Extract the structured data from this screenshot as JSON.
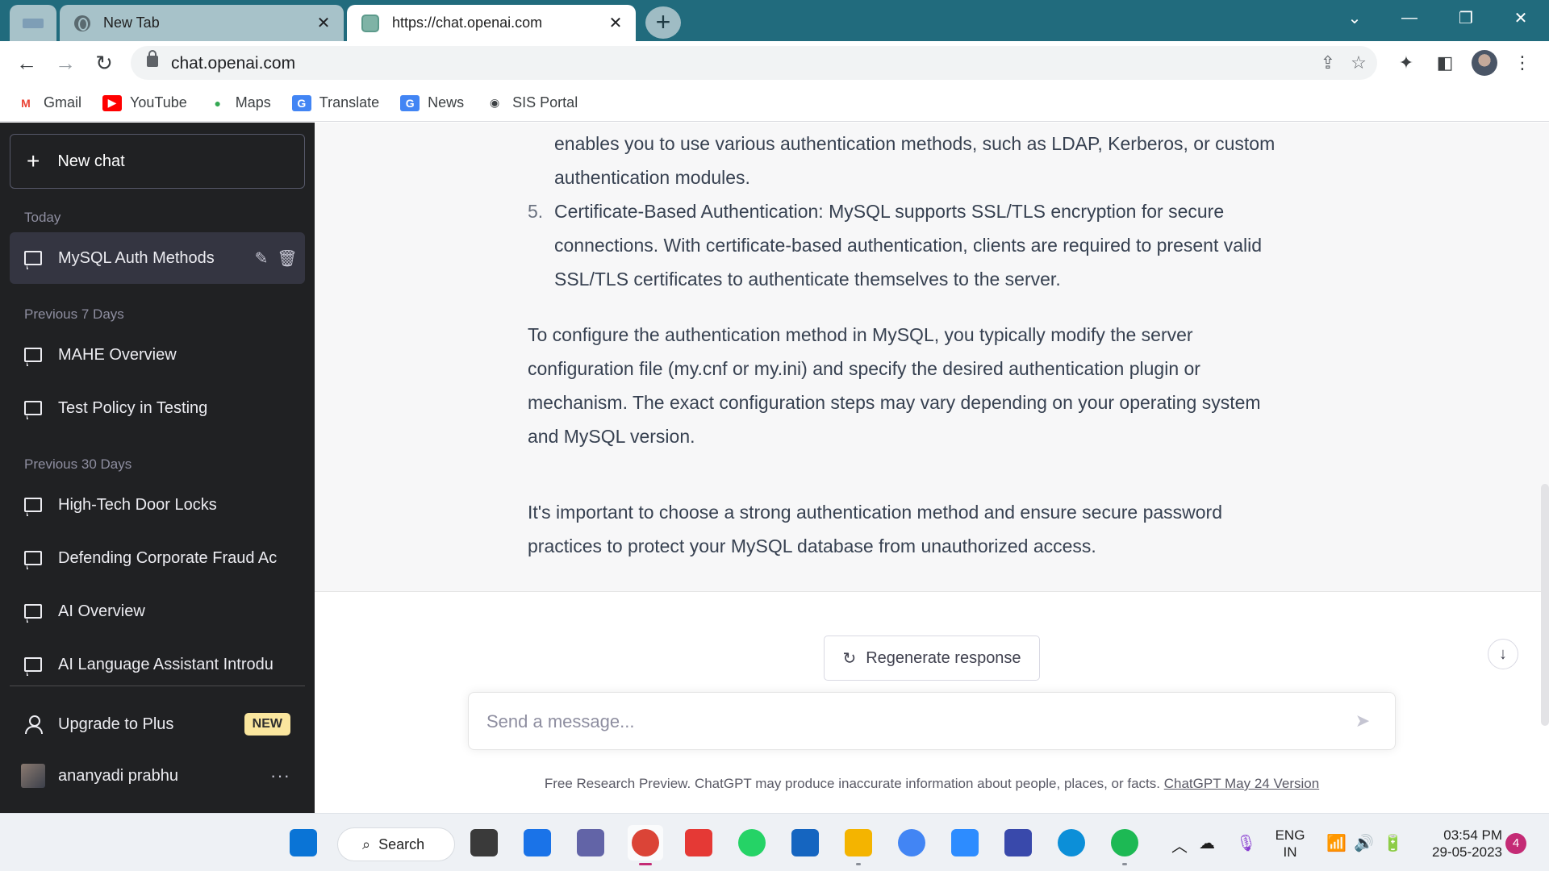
{
  "browser": {
    "tabs": [
      {
        "label": "New Tab",
        "close": "✕"
      },
      {
        "label": "https://chat.openai.com",
        "close": "✕"
      }
    ],
    "new_tab_symbol": "+",
    "window_controls": {
      "dropdown": "⌄",
      "minimize": "—",
      "restore": "❐",
      "close": "✕"
    },
    "url": "chat.openai.com",
    "nav": {
      "back": "←",
      "forward": "→",
      "reload": "↻"
    },
    "toolbar_icons": {
      "share": "⇪",
      "star": "☆",
      "extensions": "✦",
      "sidepanel": "◧",
      "menu": "⋮"
    },
    "bookmarks": [
      {
        "label": "Gmail",
        "icon": "gmail-icon",
        "glyph": "M",
        "color": "#ea4335"
      },
      {
        "label": "YouTube",
        "icon": "youtube-icon",
        "glyph": "▶",
        "color": "#ff0000"
      },
      {
        "label": "Maps",
        "icon": "maps-icon",
        "glyph": "●",
        "color": "#34a853"
      },
      {
        "label": "Translate",
        "icon": "translate-icon",
        "glyph": "G",
        "color": "#4285f4"
      },
      {
        "label": "News",
        "icon": "news-icon",
        "glyph": "G",
        "color": "#4285f4"
      },
      {
        "label": "SIS Portal",
        "icon": "globe-icon",
        "glyph": "◉",
        "color": "#3c4043"
      }
    ]
  },
  "sidebar": {
    "new_chat": "New chat",
    "sections": [
      {
        "label": "Today"
      },
      {
        "label": "Previous 7 Days"
      },
      {
        "label": "Previous 30 Days"
      }
    ],
    "chats": [
      {
        "label": "MySQL Auth Methods",
        "active": true
      },
      {
        "label": "MAHE Overview"
      },
      {
        "label": "Test Policy in Testing"
      },
      {
        "label": "High-Tech Door Locks"
      },
      {
        "label": "Defending Corporate Fraud Ac"
      },
      {
        "label": "AI Overview"
      },
      {
        "label": "AI Language Assistant Introdu"
      }
    ],
    "upgrade": "Upgrade to Plus",
    "upgrade_badge": "NEW",
    "user_name": "ananyadi prabhu",
    "more": "···"
  },
  "conversation": {
    "list_continuation": [
      "enables you to use various authentication methods, such as LDAP, Kerberos, or custom",
      "authentication modules."
    ],
    "item5_number": "5.",
    "item5_lines": [
      "Certificate-Based Authentication: MySQL supports SSL/TLS encryption for secure",
      "connections. With certificate-based authentication, clients are required to present valid",
      "SSL/TLS certificates to authenticate themselves to the server."
    ],
    "paragraph1": [
      "To configure the authentication method in MySQL, you typically modify the server",
      "configuration file (my.cnf or my.ini) and specify the desired authentication plugin or",
      "mechanism. The exact configuration steps may vary depending on your operating system",
      "and MySQL version."
    ],
    "paragraph2": [
      "It's important to choose a strong authentication method and ensure secure password",
      "practices to protect your MySQL database from unauthorized access."
    ]
  },
  "composer": {
    "regenerate": "Regenerate response",
    "placeholder": "Send a message...",
    "footnote": "Free Research Preview. ChatGPT may produce inaccurate information about people, places, or facts.",
    "version_link": "ChatGPT May 24 Version"
  },
  "taskbar": {
    "search": "Search",
    "language": "ENG",
    "region": "IN",
    "time": "03:54 PM",
    "date": "29-05-2023",
    "notifications": "4",
    "apps": [
      {
        "name": "start-button",
        "color": "#0a74d6"
      },
      {
        "name": "task-view-icon",
        "color": "#3a3a3a"
      },
      {
        "name": "widgets-icon",
        "color": "#1a73e8"
      },
      {
        "name": "teams-chat-icon",
        "color": "#6264a7"
      },
      {
        "name": "chrome-icon",
        "color": "#db4437"
      },
      {
        "name": "wps-office-icon",
        "color": "#e53935"
      },
      {
        "name": "whatsapp-icon",
        "color": "#25d366"
      },
      {
        "name": "mail-icon",
        "color": "#1565c0"
      },
      {
        "name": "file-explorer-icon",
        "color": "#f4b400"
      },
      {
        "name": "google-icon",
        "color": "#4285f4"
      },
      {
        "name": "zoom-icon",
        "color": "#2d8cff"
      },
      {
        "name": "visual-studio-icon",
        "color": "#3949ab"
      },
      {
        "name": "edge-icon",
        "color": "#0c8fd8"
      },
      {
        "name": "spotify-icon",
        "color": "#1db954"
      }
    ]
  }
}
